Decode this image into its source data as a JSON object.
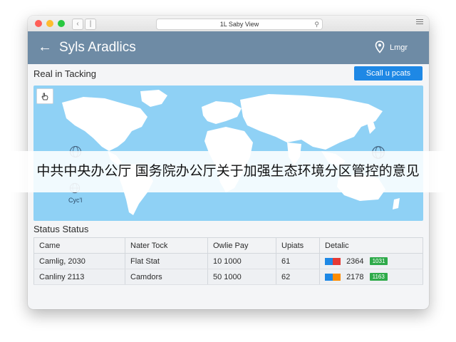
{
  "browser": {
    "url": "1L Saby View"
  },
  "header": {
    "title": "Syls Aradlics",
    "location_label": "Lmgr"
  },
  "tracking": {
    "title": "Real in Tacking",
    "button_label": "Scall u pcats",
    "map_label": "Cyc'l"
  },
  "overlay_text": "中共中央办公厅 国务院办公厅关于加强生态环境分区管控的意见",
  "status": {
    "title": "Status Status",
    "columns": [
      "Came",
      "Nater Tock",
      "Owlie Pay",
      "Upiats",
      "Detalic"
    ],
    "rows": [
      {
        "name": "Camlig, 2030",
        "tock": "Flat Stat",
        "pay": "10 1000",
        "upiats": "61",
        "detail_value": "2364",
        "badge": "1031",
        "flag_colors": [
          "#1e88e5",
          "#e53935"
        ]
      },
      {
        "name": "Canliny 2113",
        "tock": "Camdors",
        "pay": "50 1000",
        "upiats": "62",
        "detail_value": "2178",
        "badge": "1163",
        "flag_colors": [
          "#1e88e5",
          "#fb8c00"
        ]
      }
    ]
  },
  "colors": {
    "header_bg": "#6e8ba5",
    "accent": "#1e88e5",
    "map_water": "#8fd1f5",
    "badge_green": "#2eaa4a"
  },
  "icons": {
    "back": "arrow-left-icon",
    "location": "map-pin-icon",
    "map_tool": "hand-pointer-icon",
    "search": "search-icon",
    "menu": "hamburger-menu-icon"
  }
}
